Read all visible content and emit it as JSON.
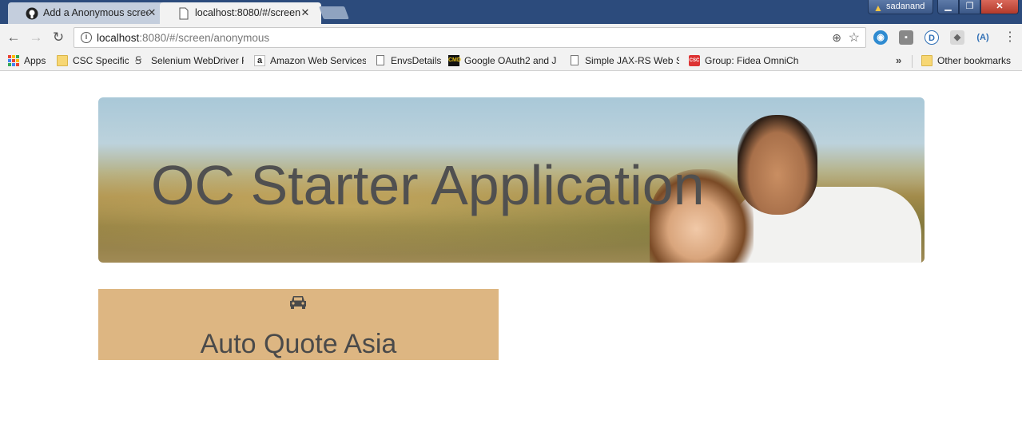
{
  "browser": {
    "tabs": [
      {
        "title": "Add a Anonymous scree",
        "active": false,
        "favicon": "github-icon"
      },
      {
        "title": "localhost:8080/#/screen/",
        "active": true,
        "favicon": "page-icon"
      }
    ],
    "window_user": "sadanand",
    "url_host": "localhost",
    "url_rest": ":8080/#/screen/anonymous",
    "bookmarks": [
      {
        "label": "Apps",
        "icon": "apps-icon"
      },
      {
        "label": "CSC Specific",
        "icon": "folder-icon"
      },
      {
        "label": "Selenium WebDriver F",
        "icon": "selenium-icon"
      },
      {
        "label": "Amazon Web Services",
        "icon": "amazon-icon"
      },
      {
        "label": "EnvsDetails",
        "icon": "page-icon"
      },
      {
        "label": "Google OAuth2 and J",
        "icon": "cmd-icon"
      },
      {
        "label": "Simple JAX-RS Web S",
        "icon": "page-icon"
      },
      {
        "label": "Group: Fidea OmniCh",
        "icon": "csc-icon"
      }
    ],
    "bookmarks_more": "»",
    "other_bookmarks": "Other bookmarks",
    "extensions": [
      "globe-extension-icon",
      "gray-extension-icon",
      "d-extension-icon",
      "shield-extension-icon",
      "a-extension-icon"
    ]
  },
  "page": {
    "hero_title": "OC Starter Application",
    "cards": [
      {
        "title": "Auto Quote Asia",
        "icon": "car-icon"
      }
    ]
  },
  "colors": {
    "titlebar": "#2c4b7c",
    "card_background": "#ddb682",
    "hero_text": "#505050"
  }
}
